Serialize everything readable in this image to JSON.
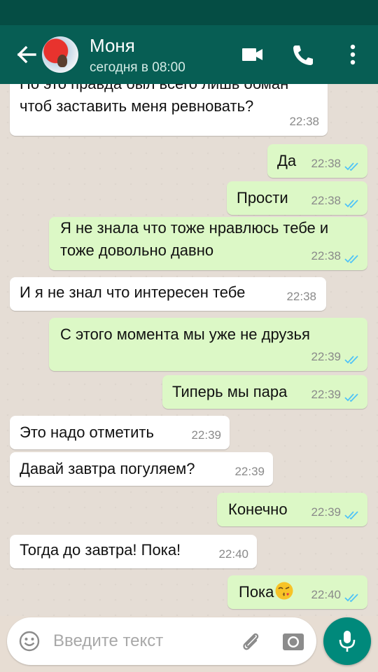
{
  "header": {
    "contact_name": "Моня",
    "last_seen": "сегодня в 08:00",
    "icons": [
      "back-arrow-icon",
      "video-call-icon",
      "phone-icon",
      "more-vert-icon"
    ]
  },
  "messages": [
    {
      "direction": "in",
      "text": "Но это правда был всего лишь обман",
      "time": ""
    },
    {
      "direction": "in",
      "text": "чтоб заставить меня ревновать?",
      "time": "22:38"
    },
    {
      "direction": "out",
      "text": "Да",
      "time": "22:38",
      "status": "read"
    },
    {
      "direction": "out",
      "text": "Прости",
      "time": "22:38",
      "status": "read"
    },
    {
      "direction": "out",
      "text": "Я не знала что тоже нравлюсь тебе и\nтоже довольно давно",
      "time": "22:38",
      "status": "read"
    },
    {
      "direction": "in",
      "text": "И я не знал что интересен тебе",
      "time": "22:38"
    },
    {
      "direction": "out",
      "text": "С этого момента мы уже не друзья",
      "time": "22:39",
      "status": "read"
    },
    {
      "direction": "out",
      "text": "Типерь мы пара",
      "time": "22:39",
      "status": "read"
    },
    {
      "direction": "in",
      "text": "Это надо отметить",
      "time": "22:39"
    },
    {
      "direction": "in",
      "text": "Давай завтра погуляем?",
      "time": "22:39"
    },
    {
      "direction": "out",
      "text": "Конечно",
      "time": "22:39",
      "status": "read"
    },
    {
      "direction": "in",
      "text": "Тогда до завтра! Пока!",
      "time": "22:40"
    },
    {
      "direction": "out",
      "text": "Пока",
      "emoji": "kissing-face-emoji",
      "time": "22:40",
      "status": "read"
    }
  ],
  "composer": {
    "placeholder": "Введите текст",
    "icons": [
      "emoji-icon",
      "attach-icon",
      "camera-icon",
      "mic-icon"
    ]
  },
  "colors": {
    "header": "#075e54",
    "status_bar": "#054d44",
    "outgoing_bubble": "#dcf8c6",
    "incoming_bubble": "#ffffff",
    "read_ticks": "#4fc3f7",
    "mic_button": "#00897b"
  }
}
